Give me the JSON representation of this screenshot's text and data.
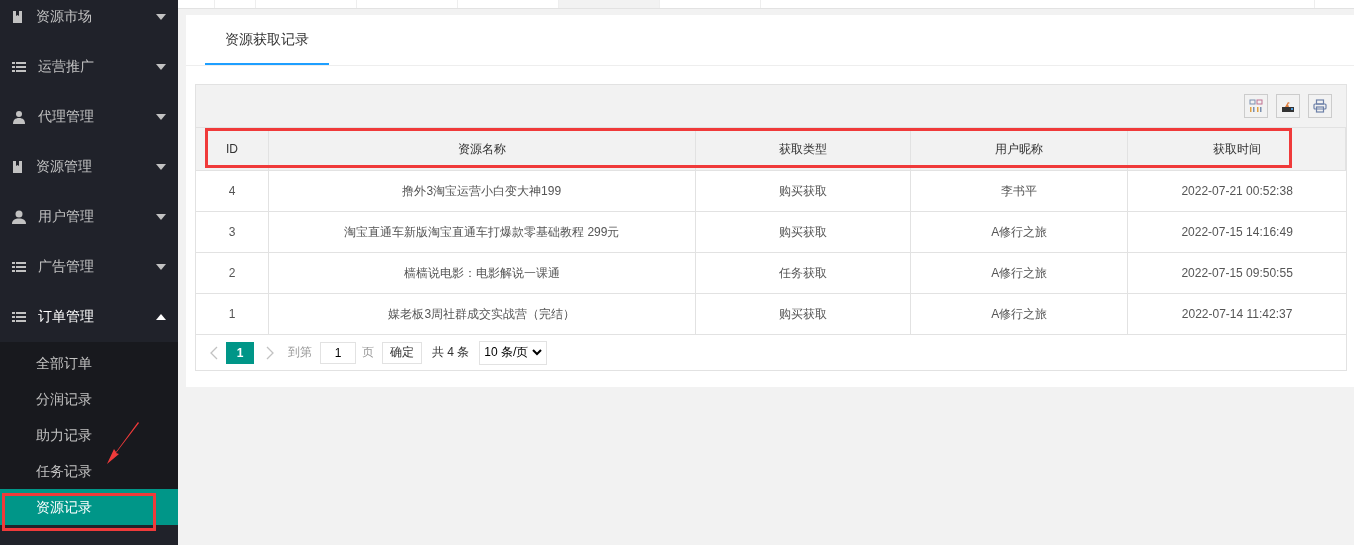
{
  "sidebar": {
    "items": [
      {
        "label": "资源市场",
        "expanded": false
      },
      {
        "label": "运营推广",
        "expanded": false
      },
      {
        "label": "代理管理",
        "expanded": false
      },
      {
        "label": "资源管理",
        "expanded": false
      },
      {
        "label": "用户管理",
        "expanded": false
      },
      {
        "label": "广告管理",
        "expanded": false
      },
      {
        "label": "订单管理",
        "expanded": true,
        "children": [
          {
            "label": "全部订单",
            "selected": false
          },
          {
            "label": "分润记录",
            "selected": false
          },
          {
            "label": "助力记录",
            "selected": false
          },
          {
            "label": "任务记录",
            "selected": false
          },
          {
            "label": "资源记录",
            "selected": true
          }
        ]
      }
    ]
  },
  "card": {
    "tabs": [
      {
        "label": "资源获取记录",
        "selected": true
      }
    ]
  },
  "table": {
    "columns": [
      "ID",
      "资源名称",
      "获取类型",
      "用户昵称",
      "获取时间"
    ],
    "rows": [
      [
        "4",
        "撸外3淘宝运营小白变大神199",
        "购买获取",
        "李书平",
        "2022-07-21 00:52:38"
      ],
      [
        "3",
        "淘宝直通车新版淘宝直通车打爆款零基础教程 299元",
        "购买获取",
        "A修行之旅",
        "2022-07-15 14:16:49"
      ],
      [
        "2",
        "樯樯说电影：电影解说一课通",
        "任务获取",
        "A修行之旅",
        "2022-07-15 09:50:55"
      ],
      [
        "1",
        "媒老板3周社群成交实战营（完结）",
        "购买获取",
        "A修行之旅",
        "2022-07-14 11:42:37"
      ]
    ]
  },
  "pagination": {
    "pages": [
      {
        "label": "1",
        "selected": true
      }
    ],
    "goto_label": "到第",
    "page_input": "1",
    "page_unit": "页",
    "confirm": "确定",
    "total": "共 4 条",
    "page_size": "10 条/页"
  }
}
